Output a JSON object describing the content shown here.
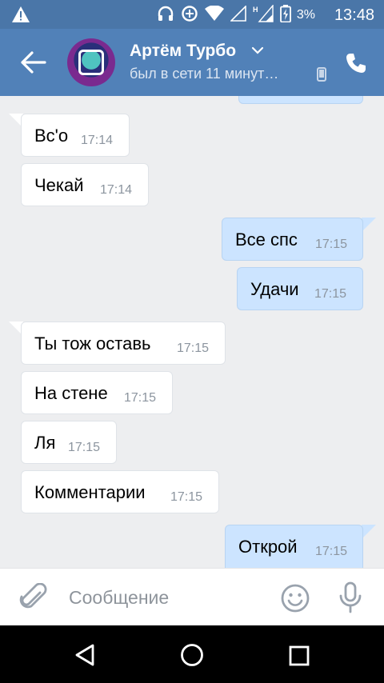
{
  "status_bar": {
    "battery": "3%",
    "time": "13:48"
  },
  "header": {
    "contact_name": "Артём Турбо",
    "contact_status": "был в сети 11 минут…"
  },
  "messages": [
    {
      "text": "Вс'о",
      "time": "17:14",
      "direction": "in"
    },
    {
      "text": "Чекай",
      "time": "17:14",
      "direction": "in"
    },
    {
      "text": "Все спс",
      "time": "17:15",
      "direction": "out"
    },
    {
      "text": "Удачи",
      "time": "17:15",
      "direction": "out"
    },
    {
      "text": "Ты тож оставь",
      "time": "17:15",
      "direction": "in"
    },
    {
      "text": "На стене",
      "time": "17:15",
      "direction": "in"
    },
    {
      "text": "Ля",
      "time": "17:15",
      "direction": "in"
    },
    {
      "text": "Комментарии",
      "time": "17:15",
      "direction": "in"
    },
    {
      "text": "Открой",
      "time": "17:15",
      "direction": "out"
    }
  ],
  "composer": {
    "placeholder": "Сообщение"
  },
  "icons": {
    "header": [
      "back-arrow-icon",
      "avatar",
      "chevron-down-icon",
      "mobile-device-icon",
      "phone-icon"
    ],
    "composer": [
      "paperclip-icon",
      "emoji-icon",
      "microphone-icon"
    ],
    "navbar": [
      "nav-back-icon",
      "nav-home-icon",
      "nav-recents-icon"
    ]
  },
  "colors": {
    "header": "#5181b8",
    "status_bar": "#4a76a8",
    "outgoing_bubble": "#cce4ff",
    "incoming_bubble": "#ffffff",
    "background": "#edeef0"
  }
}
